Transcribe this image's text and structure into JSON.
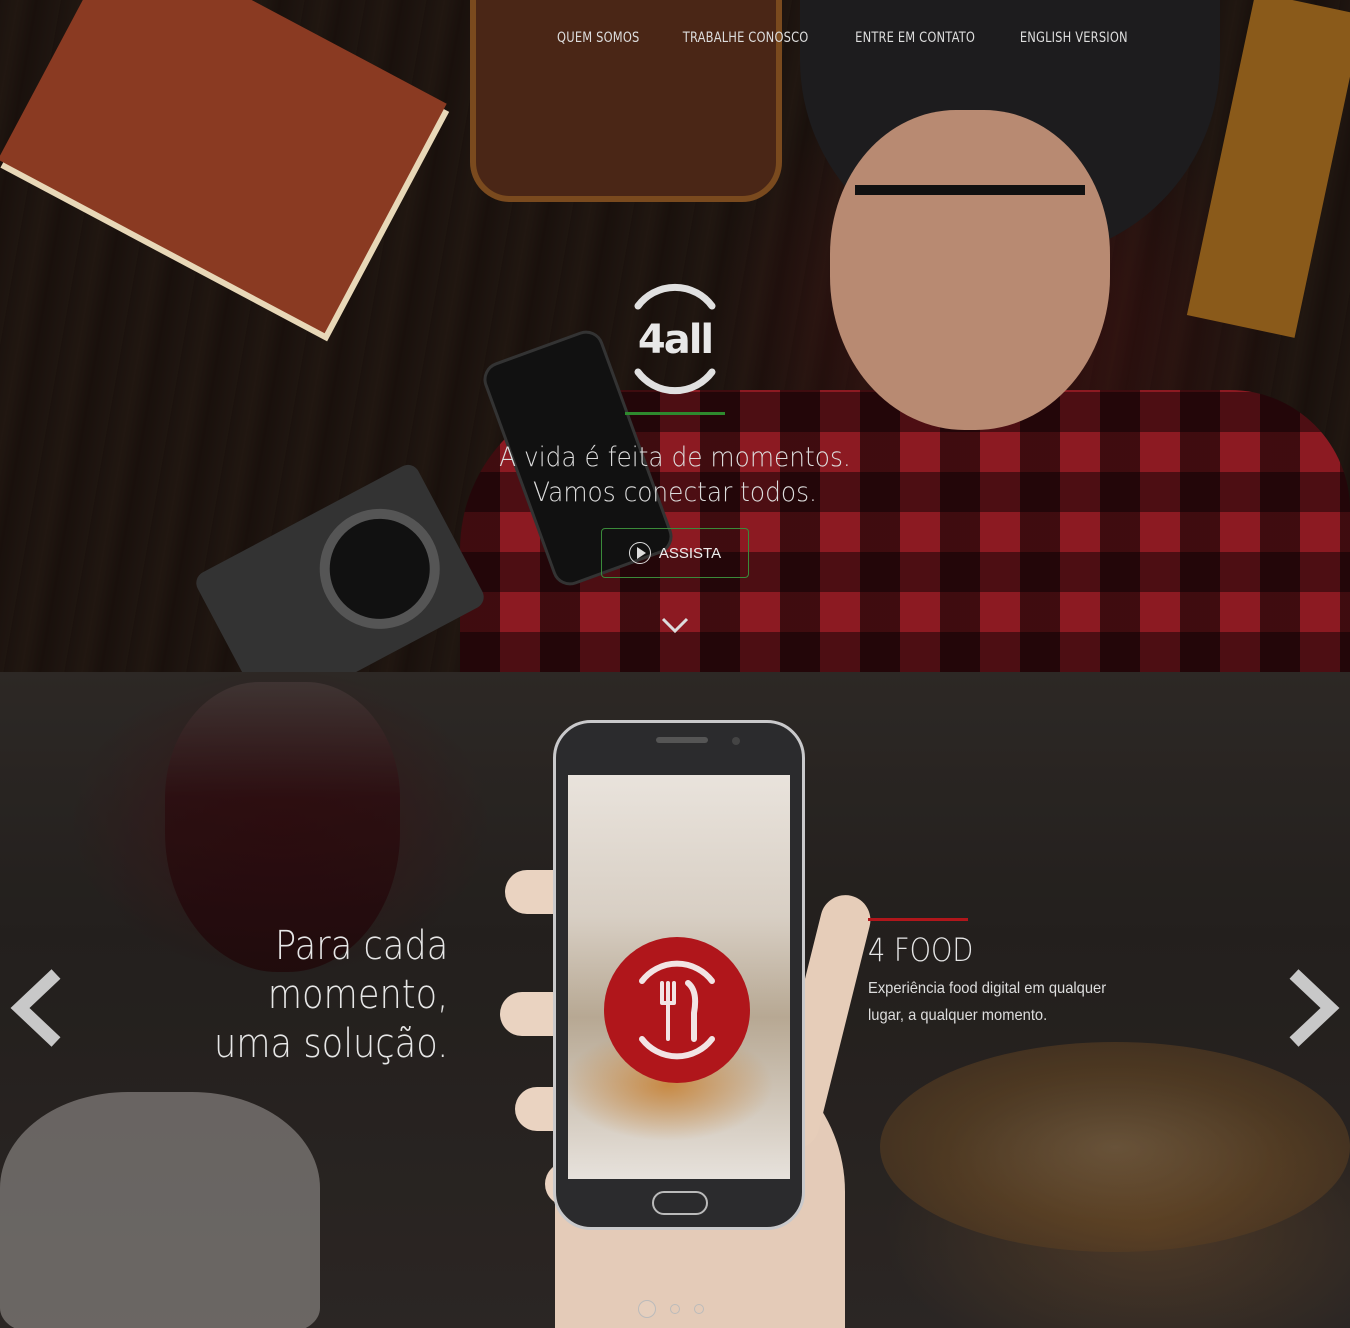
{
  "nav": {
    "items": [
      {
        "label": "QUEM SOMOS"
      },
      {
        "label": "TRABALHE CONOSCO"
      },
      {
        "label": "ENTRE EM CONTATO"
      },
      {
        "label": "ENGLISH VERSION"
      }
    ]
  },
  "hero": {
    "logo_text": "4all",
    "tagline_line1": "A vida é feita de momentos.",
    "tagline_line2": "Vamos conectar todos.",
    "watch_label": "ASSISTA"
  },
  "solutions": {
    "headline_line1": "Para cada",
    "headline_line2": "momento,",
    "headline_line3": "uma solução.",
    "product_name": "4 FOOD",
    "product_description": "Experiência food digital em qualquer lugar, a qualquer momento.",
    "slide_count": 3,
    "active_slide": 1
  },
  "colors": {
    "brand_green": "#2e8a2e",
    "brand_red": "#b0161b"
  },
  "icons": [
    "4all-logo",
    "play-icon",
    "chevron-down-icon",
    "chevron-left-icon",
    "chevron-right-icon",
    "fork-knife-icon"
  ]
}
